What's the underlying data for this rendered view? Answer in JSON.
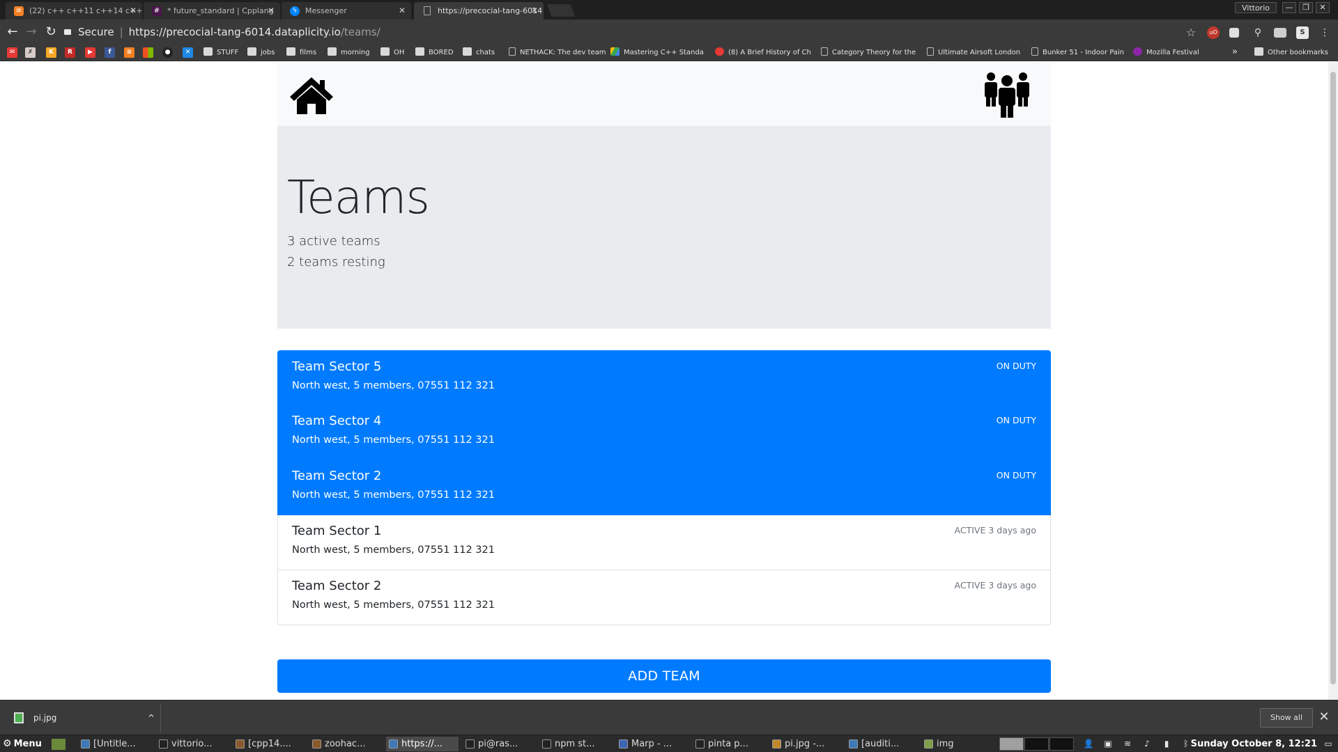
{
  "browser": {
    "tabs": [
      {
        "title": "(22) c++ c++11 c++14 c++",
        "favicon": "stackoverflow-icon"
      },
      {
        "title": "* future_standard | Cpplang",
        "favicon": "slack-icon"
      },
      {
        "title": "Messenger",
        "favicon": "messenger-icon"
      },
      {
        "title": "https://precocial-tang-6014",
        "favicon": "page-icon"
      }
    ],
    "profile": "Vittorio",
    "window_controls": {
      "minimize": "—",
      "restore": "❐",
      "close": "✕"
    },
    "security_label": "Secure",
    "url_host": "https://precocial-tang-6014.dataplicity.io",
    "url_path": "/teams/",
    "bookmarks": [
      {
        "label": "STUFF",
        "kind": "folder"
      },
      {
        "label": "jobs",
        "kind": "folder"
      },
      {
        "label": "films",
        "kind": "folder"
      },
      {
        "label": "morning",
        "kind": "folder"
      },
      {
        "label": "OH",
        "kind": "folder"
      },
      {
        "label": "BORED",
        "kind": "folder"
      },
      {
        "label": "chats",
        "kind": "folder"
      },
      {
        "label": "NETHACK: The dev team",
        "kind": "page"
      },
      {
        "label": "Mastering C++ Standa",
        "kind": "page"
      },
      {
        "label": "(8) A Brief History of Ch",
        "kind": "page"
      },
      {
        "label": "Category Theory for the",
        "kind": "page"
      },
      {
        "label": "Ultimate Airsoft London",
        "kind": "page"
      },
      {
        "label": "Bunker 51 - Indoor Pain",
        "kind": "page"
      },
      {
        "label": "Mozilla Festival",
        "kind": "page"
      }
    ],
    "overflow": "»",
    "other_bookmarks": "Other bookmarks"
  },
  "page": {
    "title": "Teams",
    "active_count_text": "3 active teams",
    "resting_count_text": "2 teams resting",
    "teams": [
      {
        "name": "Team Sector 5",
        "details": "North west, 5 members, 07551 112 321",
        "status": "ON DUTY",
        "highlighted": true
      },
      {
        "name": "Team Sector 4",
        "details": "North west, 5 members, 07551 112 321",
        "status": "ON DUTY",
        "highlighted": true
      },
      {
        "name": "Team Sector 2",
        "details": "North west, 5 members, 07551 112 321",
        "status": "ON DUTY",
        "highlighted": true
      },
      {
        "name": "Team Sector 1",
        "details": "North west, 5 members, 07551 112 321",
        "status": "ACTIVE 3 days ago",
        "highlighted": false
      },
      {
        "name": "Team Sector 2",
        "details": "North west, 5 members, 07551 112 321",
        "status": "ACTIVE 3 days ago",
        "highlighted": false
      }
    ],
    "add_button": "ADD TEAM",
    "colors": {
      "primary": "#007bff",
      "jumbotron": "#e9ecef",
      "navbar": "#f8f9fa"
    }
  },
  "downloads": {
    "file": "pi.jpg",
    "show_all": "Show all",
    "close": "✕"
  },
  "taskbar": {
    "menu": "Menu",
    "items": [
      {
        "label": "[Untitle...",
        "active": false
      },
      {
        "label": "vittorio...",
        "active": false
      },
      {
        "label": "[cpp14....",
        "active": false
      },
      {
        "label": "zoohac...",
        "active": false
      },
      {
        "label": "https://...",
        "active": true
      },
      {
        "label": "pi@ras...",
        "active": false
      },
      {
        "label": "npm st...",
        "active": false
      },
      {
        "label": "Marp - ...",
        "active": false
      },
      {
        "label": "pinta p...",
        "active": false
      },
      {
        "label": "pi.jpg -...",
        "active": false
      },
      {
        "label": "[auditi...",
        "active": false
      },
      {
        "label": "img",
        "active": false
      }
    ],
    "clock": "Sunday October  8, 12:21"
  }
}
